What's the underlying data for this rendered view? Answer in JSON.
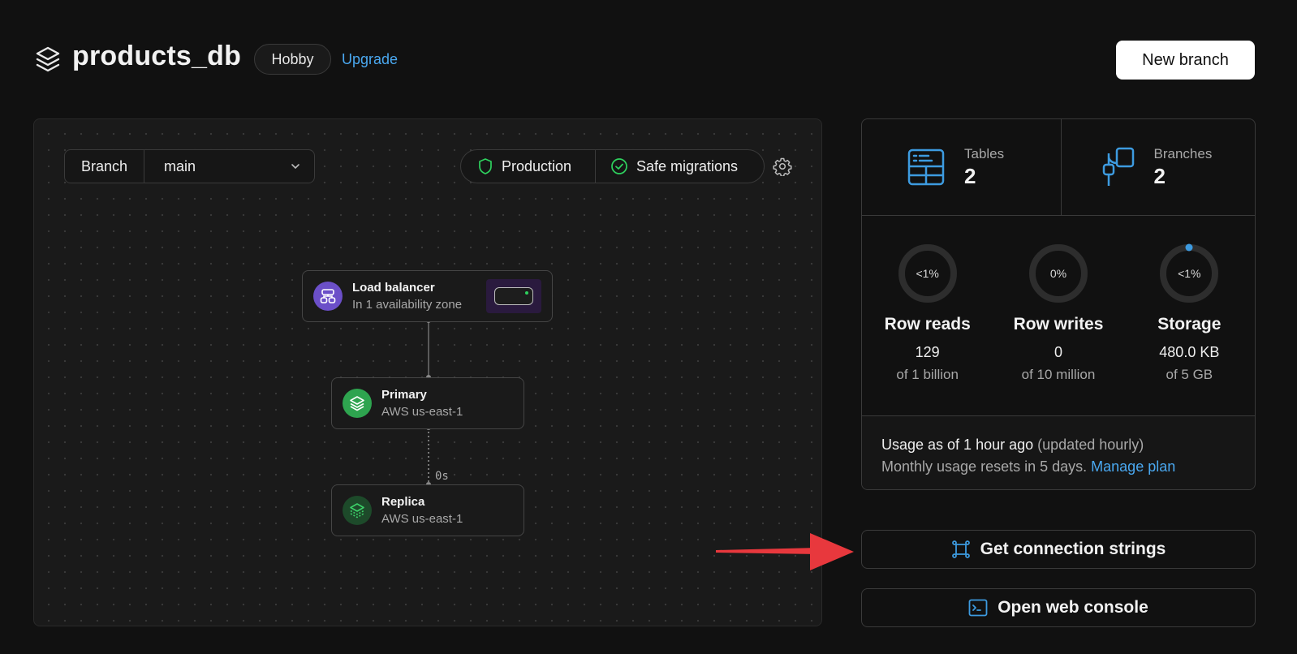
{
  "header": {
    "title": "products_db",
    "plan_badge": "Hobby",
    "upgrade_link": "Upgrade",
    "new_branch_button": "New branch"
  },
  "canvas": {
    "branch_label": "Branch",
    "branch_value": "main",
    "status": {
      "production": "Production",
      "safe_migrations": "Safe migrations"
    },
    "nodes": {
      "load_balancer": {
        "title": "Load balancer",
        "subtitle": "In 1 availability zone"
      },
      "primary": {
        "title": "Primary",
        "subtitle": "AWS us-east-1"
      },
      "replica": {
        "title": "Replica",
        "subtitle": "AWS us-east-1"
      }
    },
    "replication_lag": "0s"
  },
  "stats": {
    "tables": {
      "label": "Tables",
      "value": "2"
    },
    "branches": {
      "label": "Branches",
      "value": "2"
    },
    "metrics": [
      {
        "name": "Row reads",
        "percent_label": "<1%",
        "used": "129",
        "limit": "of 1 billion",
        "fill_fraction": 0.0
      },
      {
        "name": "Row writes",
        "percent_label": "0%",
        "used": "0",
        "limit": "of 10 million",
        "fill_fraction": 0.0
      },
      {
        "name": "Storage",
        "percent_label": "<1%",
        "used": "480.0 KB",
        "limit": "of 5 GB",
        "fill_fraction": 0.0001
      }
    ],
    "usage_note": {
      "line1": "Usage as of 1 hour ago",
      "line1_muted": "(updated hourly)",
      "line2": "Monthly usage resets in 5 days.",
      "manage_link": "Manage plan"
    }
  },
  "actions": {
    "connection_strings": "Get connection strings",
    "web_console": "Open web console"
  },
  "colors": {
    "background": "#111111",
    "accent_blue": "#4aa8f0",
    "annotation_arrow": "#e8383d",
    "primary_node": "#2ea44f",
    "load_balancer_node": "#6b4fc8"
  }
}
